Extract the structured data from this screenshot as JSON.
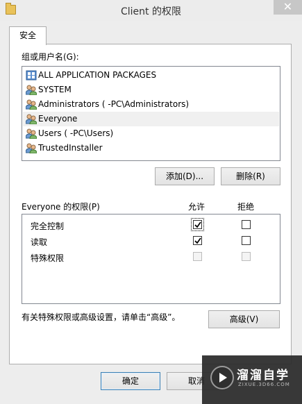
{
  "window": {
    "title": "Client 的权限",
    "close_glyph": "✕"
  },
  "tabs": [
    {
      "label": "安全",
      "active": true
    }
  ],
  "groups": {
    "label": "组或用户名(G):",
    "items": [
      {
        "label": "ALL APPLICATION PACKAGES",
        "icon": "app-packages-icon",
        "selected": false
      },
      {
        "label": "SYSTEM",
        "icon": "users-group-icon",
        "selected": false
      },
      {
        "label": "Administrators (        -PC\\Administrators)",
        "icon": "users-group-icon",
        "selected": false
      },
      {
        "label": "Everyone",
        "icon": "users-group-icon",
        "selected": true
      },
      {
        "label": "Users (        -PC\\Users)",
        "icon": "users-group-icon",
        "selected": false
      },
      {
        "label": "TrustedInstaller",
        "icon": "users-group-icon",
        "selected": false
      }
    ]
  },
  "buttons": {
    "add": "添加(D)...",
    "remove": "删除(R)",
    "advanced": "高级(V)",
    "ok": "确定",
    "cancel": "取消"
  },
  "permissions": {
    "label": "Everyone 的权限(P)",
    "allow_header": "允许",
    "deny_header": "拒绝",
    "rows": [
      {
        "name": "完全控制",
        "allow": true,
        "deny": false,
        "enabled": true
      },
      {
        "name": "读取",
        "allow": true,
        "deny": false,
        "enabled": true
      },
      {
        "name": "特殊权限",
        "allow": false,
        "deny": false,
        "enabled": false
      }
    ]
  },
  "advanced_hint": "有关特殊权限或高级设置，请单击“高级”。",
  "watermark": {
    "brand": "溜溜自学",
    "url": "ZIXUE.3D66.COM"
  },
  "colors": {
    "selection_bg": "#f0f0f0",
    "focus_border": "#3c7fb1",
    "close_bg": "#c7c7c7"
  }
}
